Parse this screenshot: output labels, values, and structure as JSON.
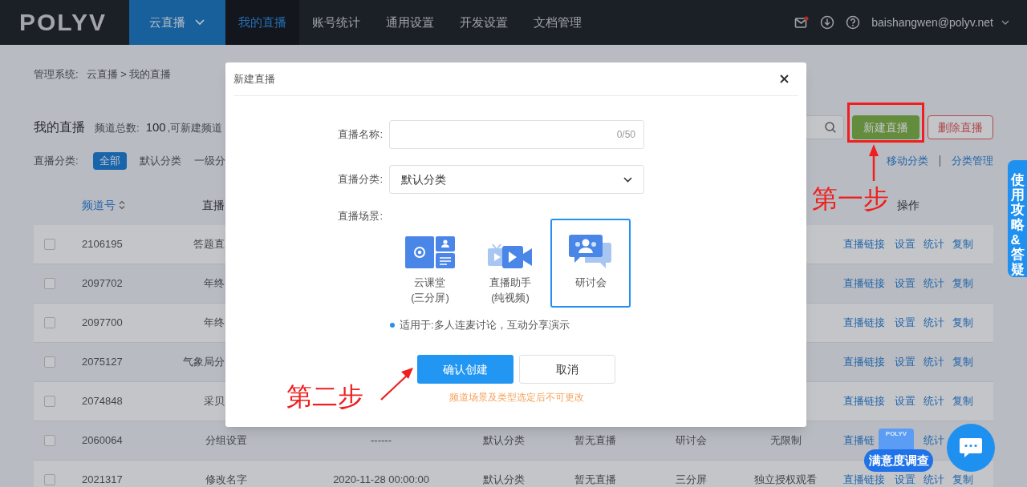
{
  "nav": {
    "logo": "POLYV",
    "product": "云直播",
    "items": [
      {
        "label": "我的直播",
        "selected": true
      },
      {
        "label": "账号统计",
        "selected": false
      },
      {
        "label": "通用设置",
        "selected": false
      },
      {
        "label": "开发设置",
        "selected": false
      },
      {
        "label": "文档管理",
        "selected": false
      }
    ],
    "mail_unread": true,
    "user": "baishangwen@polyv.net"
  },
  "breadcrumb": {
    "label": "管理系统:",
    "path": "云直播 > 我的直播"
  },
  "header": {
    "title": "我的直播",
    "count_label": "频道总数:",
    "count": "100",
    "remaining_label": ",可新建频道"
  },
  "categories": {
    "label": "直播分类:",
    "items": [
      {
        "label": "全部",
        "selected": true
      },
      {
        "label": "默认分类",
        "selected": false
      },
      {
        "label": "一级分",
        "selected": false
      }
    ]
  },
  "toolbar": {
    "create": "新建直播",
    "delete": "删除直播",
    "links": [
      "移动分类",
      "分类管理"
    ]
  },
  "table": {
    "columns": [
      {
        "kind": "id",
        "label": "频道号",
        "sortable": true
      },
      {
        "kind": "name",
        "label": "直播",
        "sortable": false,
        "clipped": true
      },
      {
        "kind": "actions",
        "label": "操作",
        "sortable": false
      }
    ],
    "rows": [
      {
        "checked": false,
        "clipped": true,
        "cells": {
          "id": "2106195",
          "name": "答题直"
        },
        "actions": [
          {
            "label": "直播链接"
          },
          {
            "label": "设置"
          },
          {
            "label": "统计"
          },
          {
            "label": "复制"
          }
        ]
      },
      {
        "checked": false,
        "clipped": true,
        "cells": {
          "id": "2097702",
          "name": "年终"
        },
        "actions": [
          {
            "label": "直播链接"
          },
          {
            "label": "设置"
          },
          {
            "label": "统计"
          },
          {
            "label": "复制"
          }
        ]
      },
      {
        "checked": false,
        "clipped": true,
        "cells": {
          "id": "2097700",
          "name": "年终"
        },
        "actions": [
          {
            "label": "直播链接"
          },
          {
            "label": "设置"
          },
          {
            "label": "统计"
          },
          {
            "label": "复制"
          }
        ]
      },
      {
        "checked": false,
        "clipped": true,
        "cells": {
          "id": "2075127",
          "name": "气象局分"
        },
        "actions": [
          {
            "label": "直播链接"
          },
          {
            "label": "设置"
          },
          {
            "label": "统计"
          },
          {
            "label": "复制"
          }
        ]
      },
      {
        "checked": false,
        "clipped": true,
        "cells": {
          "id": "2074848",
          "name": "采贝"
        },
        "actions": [
          {
            "label": "直播链接"
          },
          {
            "label": "设置"
          },
          {
            "label": "统计"
          },
          {
            "label": "复制"
          }
        ]
      },
      {
        "checked": false,
        "clipped": false,
        "cells": {
          "id": "2060064",
          "name": "分组设置",
          "start_time": "------",
          "category": "默认分类",
          "status": "暂无直播",
          "scene": "研讨会",
          "access": "无限制"
        },
        "actions": [
          {
            "label": "直播链"
          },
          {
            "label": "统计",
            "after_gap": true
          }
        ]
      },
      {
        "checked": false,
        "clipped": false,
        "cells": {
          "id": "2021317",
          "name": "修改名字",
          "start_time": "2020-11-28 00:00:00",
          "category": "默认分类",
          "status": "暂无直播",
          "scene": "三分屏",
          "access": "独立授权观看"
        },
        "actions": [
          {
            "label": "直播链接"
          },
          {
            "label": "设置"
          },
          {
            "label": "统计"
          },
          {
            "label": "复制"
          }
        ]
      }
    ]
  },
  "dialog": {
    "title": "新建直播",
    "name_label": "直播名称:",
    "name_counter": "0/50",
    "category_label": "直播分类:",
    "category_value": "默认分类",
    "scene_label": "直播场景:",
    "scenes": [
      {
        "kind": "classroom",
        "title": "云课堂",
        "subtitle": "(三分屏)",
        "selected": false
      },
      {
        "kind": "assistant",
        "title": "直播助手",
        "subtitle": "(纯视频)",
        "selected": false
      },
      {
        "kind": "seminar",
        "title": "研讨会",
        "selected": true
      }
    ],
    "hint": "适用于:多人连麦讨论，互动分享演示",
    "confirm": "确认创建",
    "cancel": "取消",
    "warning": "频道场景及类型选定后不可更改"
  },
  "annotations": {
    "step_one": "第一步",
    "step_two": "第二步"
  },
  "help_tab": "使用攻略&答疑",
  "survey": {
    "logo": "POLYV",
    "label": "满意度调查"
  }
}
